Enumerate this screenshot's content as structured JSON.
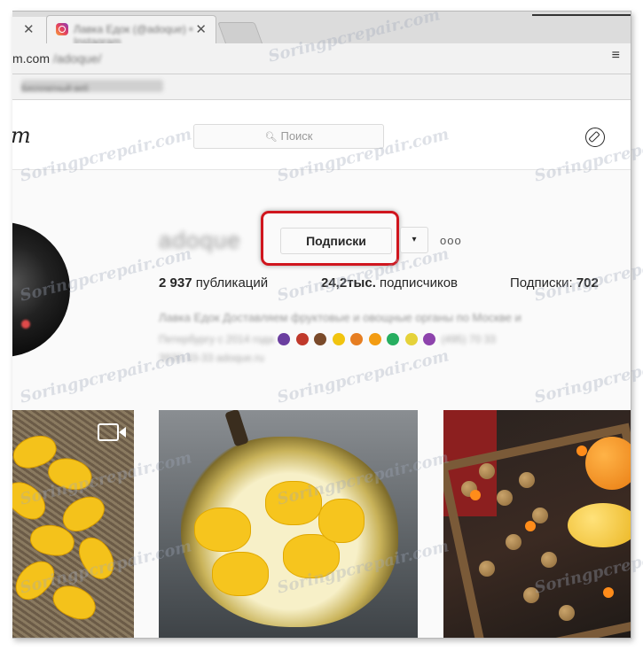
{
  "browser": {
    "tab_title": "Лавка Едок (@adoque) • Instagram",
    "address_partial": "m.com",
    "address_blurred": "/adoque/",
    "bookmark": "Бесплатный веб"
  },
  "instagram": {
    "logo_partial": "m",
    "search_placeholder": "Поиск"
  },
  "profile": {
    "username": "adoque",
    "follow_button": "Подписки",
    "dropdown_arrow": "▾",
    "more_dots": "ooo",
    "posts_count": "2 937",
    "posts_label": "публикаций",
    "followers_count": "24,2тыс.",
    "followers_label": "подписчиков",
    "following_label": "Подписки:",
    "following_count": "702",
    "bio_line1": "Лавка Едок Доставляем фруктовые и овощные органы по Москве и",
    "bio_line2": "Петербургу с 2014 года",
    "bio_line3": "(495) 70 33",
    "bio_line4": "3930-33-33 adoque.ru"
  },
  "icons": {
    "compass": "compass-icon",
    "search": "search-icon",
    "video": "video-camera-icon",
    "close": "close-icon"
  },
  "watermark": "Soringpcrepair.com",
  "colors": {
    "highlight": "#d0161e",
    "mango": "#f4c21b"
  }
}
